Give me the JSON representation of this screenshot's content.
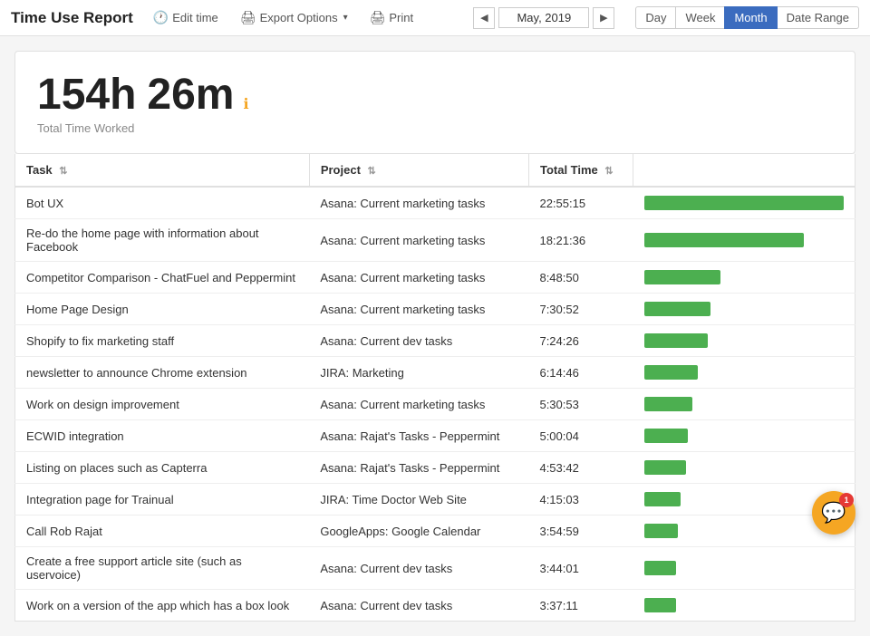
{
  "header": {
    "title": "Time Use Report",
    "edit_time_label": "Edit time",
    "export_label": "Export Options",
    "print_label": "Print",
    "date": "May, 2019",
    "views": [
      "Day",
      "Week",
      "Month",
      "Date Range"
    ],
    "active_view": "Month"
  },
  "summary": {
    "hours": "154h",
    "mins": "26m",
    "label": "Total Time Worked"
  },
  "table": {
    "columns": [
      "Task",
      "Project",
      "Total Time"
    ],
    "rows": [
      {
        "task": "Bot UX",
        "project": "Asana: Current marketing tasks",
        "time": "22:55:15",
        "bar_pct": 100
      },
      {
        "task": "Re-do the home page with information about Facebook",
        "project": "Asana: Current marketing tasks",
        "time": "18:21:36",
        "bar_pct": 80
      },
      {
        "task": "Competitor Comparison - ChatFuel and Peppermint",
        "project": "Asana: Current marketing tasks",
        "time": "8:48:50",
        "bar_pct": 38
      },
      {
        "task": "Home Page Design",
        "project": "Asana: Current marketing tasks",
        "time": "7:30:52",
        "bar_pct": 33
      },
      {
        "task": "Shopify to fix marketing staff",
        "project": "Asana: Current dev tasks",
        "time": "7:24:26",
        "bar_pct": 32
      },
      {
        "task": "newsletter to announce Chrome extension",
        "project": "JIRA: Marketing",
        "time": "6:14:46",
        "bar_pct": 27
      },
      {
        "task": "Work on design improvement",
        "project": "Asana: Current marketing tasks",
        "time": "5:30:53",
        "bar_pct": 24
      },
      {
        "task": "ECWID integration",
        "project": "Asana: Rajat's Tasks - Peppermint",
        "time": "5:00:04",
        "bar_pct": 22
      },
      {
        "task": "Listing on places such as Capterra",
        "project": "Asana: Rajat's Tasks - Peppermint",
        "time": "4:53:42",
        "bar_pct": 21
      },
      {
        "task": "Integration page for Trainual",
        "project": "JIRA: Time Doctor Web Site",
        "time": "4:15:03",
        "bar_pct": 18
      },
      {
        "task": "Call Rob Rajat",
        "project": "GoogleApps: Google Calendar",
        "time": "3:54:59",
        "bar_pct": 17
      },
      {
        "task": "Create a free support article site (such as uservoice)",
        "project": "Asana: Current dev tasks",
        "time": "3:44:01",
        "bar_pct": 16
      },
      {
        "task": "Work on a version of the app which has a box look",
        "project": "Asana: Current dev tasks",
        "time": "3:37:11",
        "bar_pct": 16
      }
    ]
  },
  "chat": {
    "badge": "1",
    "icon": "💬"
  }
}
